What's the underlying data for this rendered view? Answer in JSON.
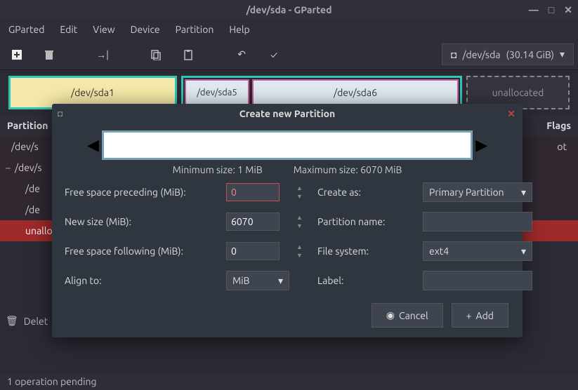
{
  "window": {
    "title": "/dev/sda - GParted"
  },
  "menu": {
    "items": [
      "GParted",
      "Edit",
      "View",
      "Device",
      "Partition",
      "Help"
    ]
  },
  "toolbar": {
    "device": "/dev/sda",
    "device_size": "(30.14 GiB)"
  },
  "diskmap": {
    "p1": "/dev/sda1",
    "p5": "/dev/sda5",
    "p6": "/dev/sda6",
    "unalloc": "unallocated"
  },
  "table": {
    "col_partition": "Partition",
    "col_flags": "Flags"
  },
  "rows": {
    "r0": "/dev/s",
    "r1": "/dev/s",
    "r2": "/de",
    "r3": "/de",
    "r4": "unallo",
    "flag0": "ot"
  },
  "statusbar": {
    "text": "1 operation pending"
  },
  "delete_entry": "Delet",
  "dialog": {
    "title": "Create new Partition",
    "min_size": "Minimum size: 1 MiB",
    "max_size": "Maximum size: 6070 MiB",
    "free_preceding_label": "Free space preceding (MiB):",
    "free_preceding_value": "0",
    "new_size_label": "New size (MiB):",
    "new_size_value": "6070",
    "free_following_label": "Free space following (MiB):",
    "free_following_value": "0",
    "align_label": "Align to:",
    "align_value": "MiB",
    "create_as_label": "Create as:",
    "create_as_value": "Primary Partition",
    "partition_name_label": "Partition name:",
    "partition_name_value": "",
    "filesystem_label": "File system:",
    "filesystem_value": "ext4",
    "label_label": "Label:",
    "label_value": "",
    "cancel": "Cancel",
    "add": "Add"
  }
}
